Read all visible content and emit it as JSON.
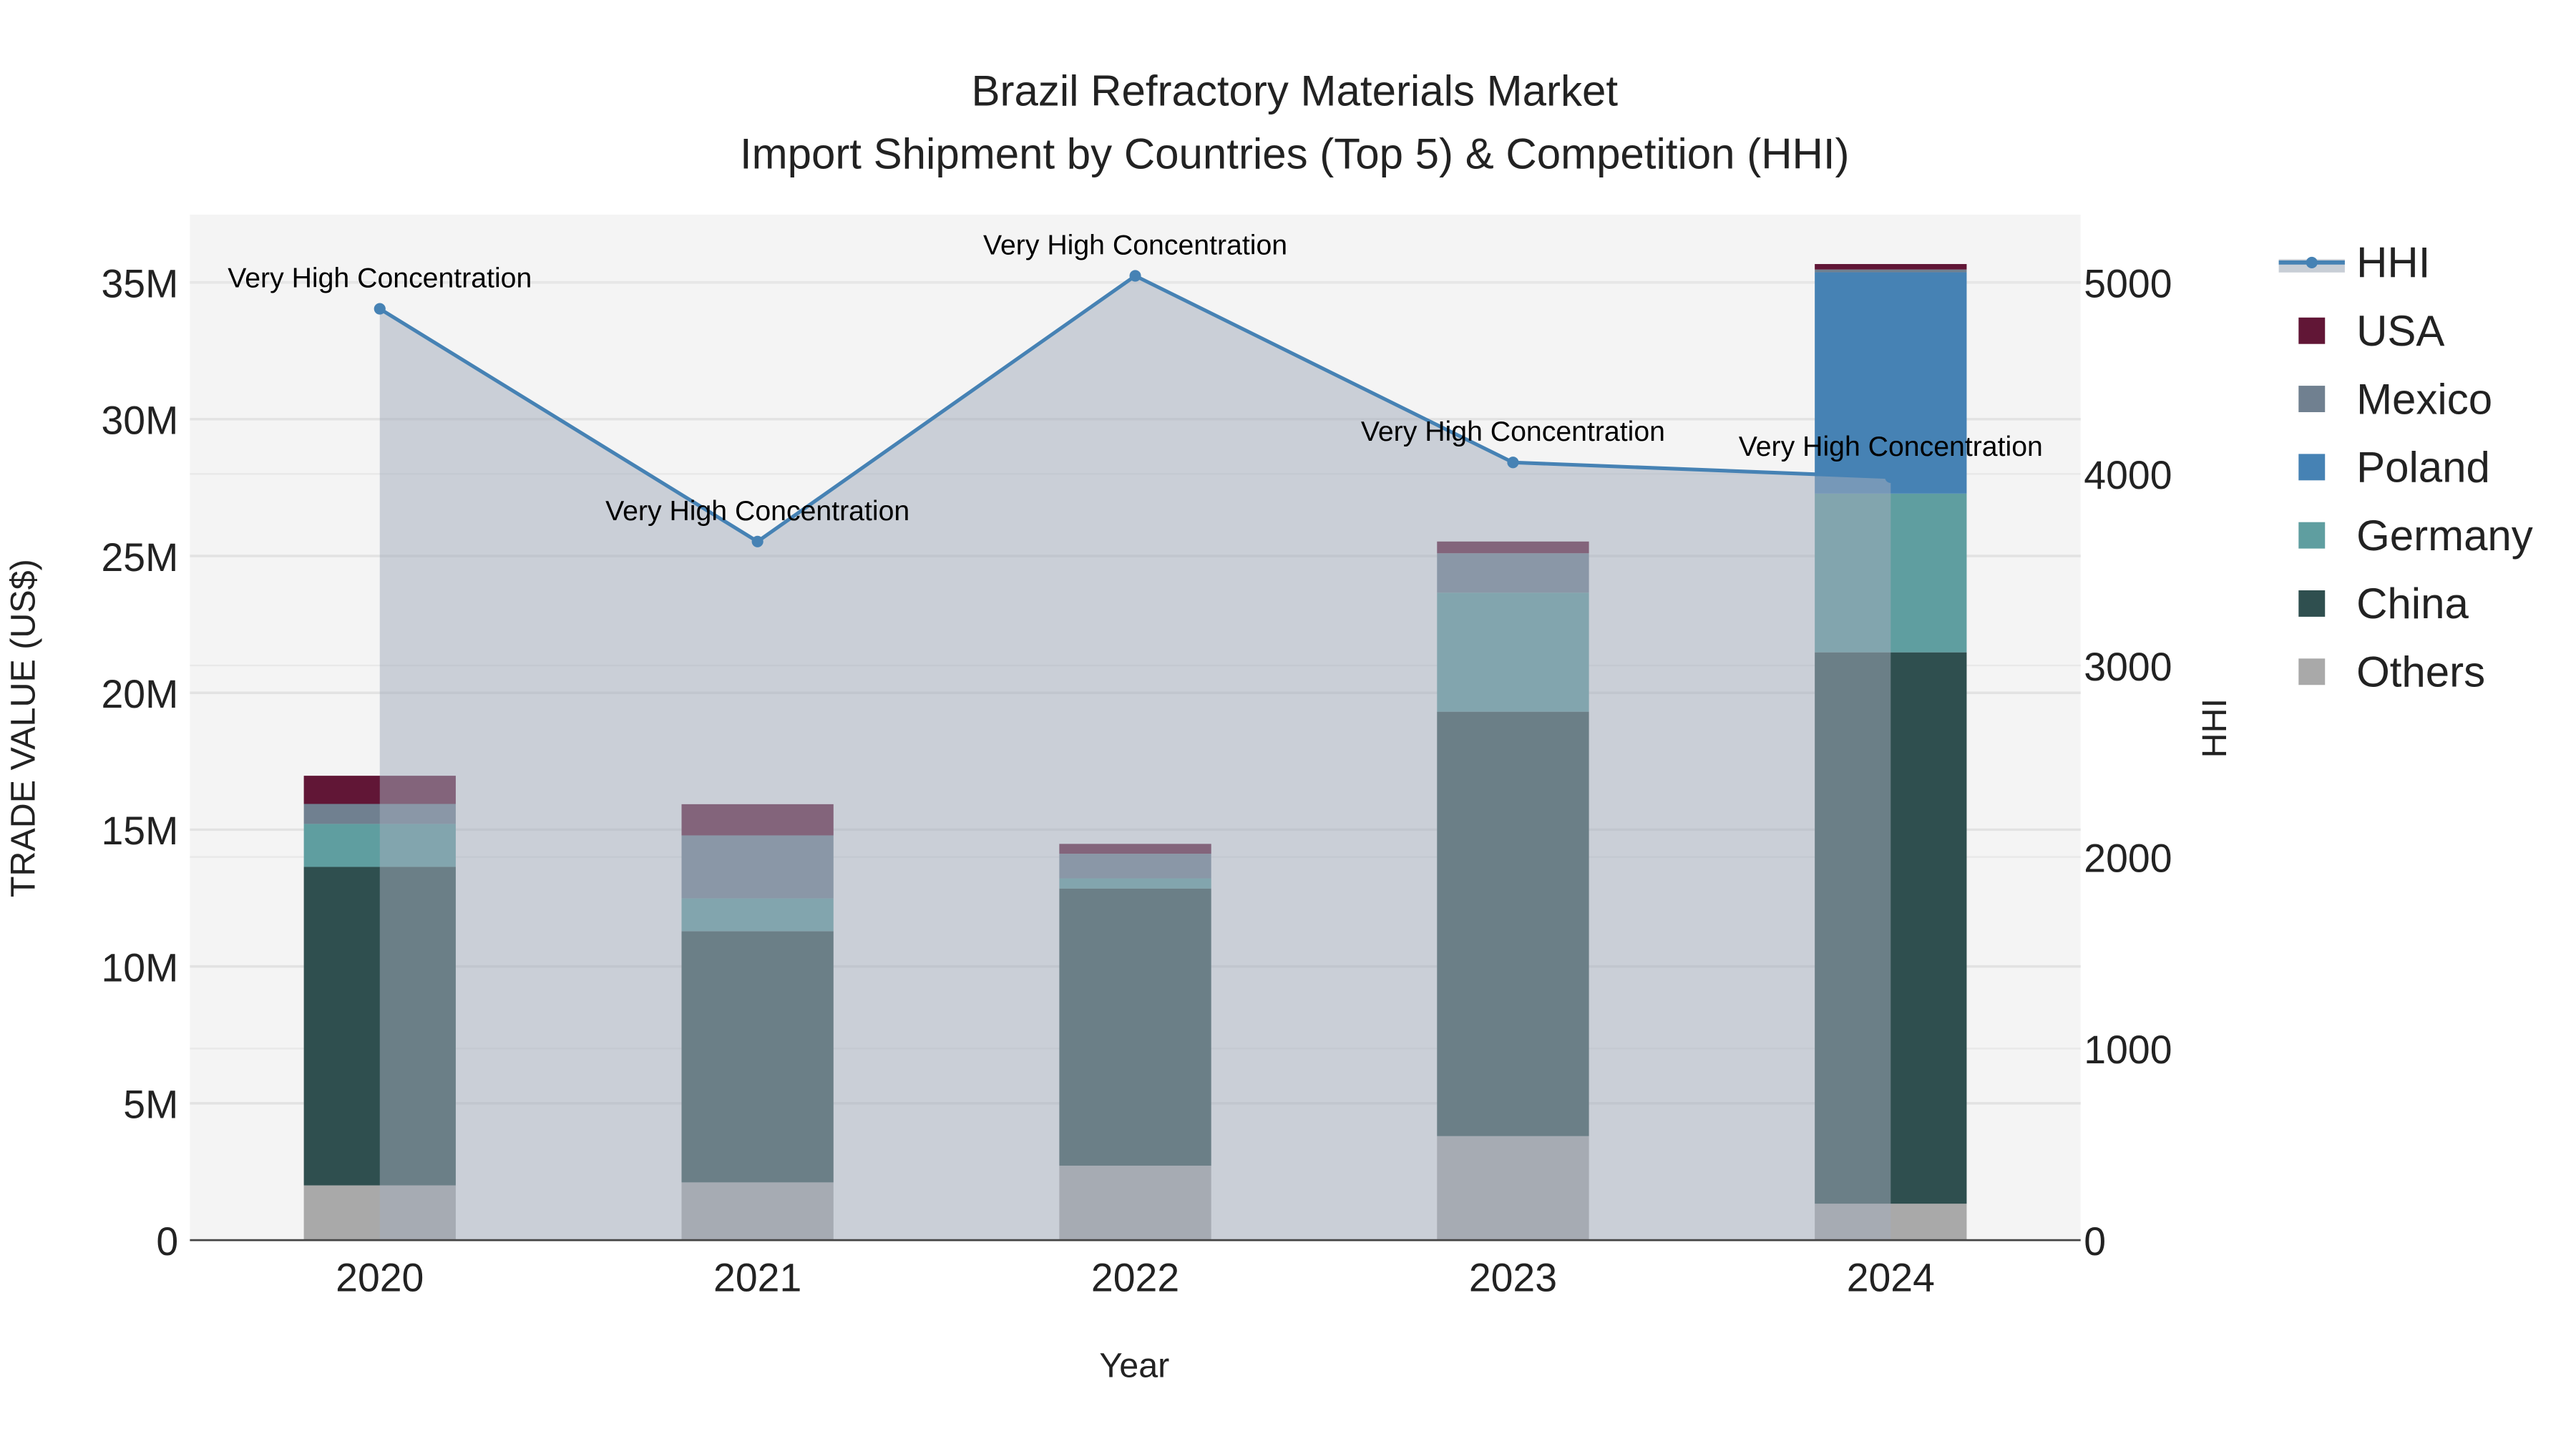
{
  "chart_data": {
    "type": "bar",
    "title": "Brazil Refractory Materials Market",
    "subtitle": "Import Shipment by Countries (Top 5) & Competition (HHI)",
    "xlabel": "Year",
    "ylabel": "TRADE VALUE (US$)",
    "y2label": "HHI",
    "categories": [
      "2020",
      "2021",
      "2022",
      "2023",
      "2024"
    ],
    "ylim": [
      0,
      37500000
    ],
    "y2lim": [
      0,
      5350
    ],
    "yticks": [
      {
        "v": 0,
        "label": "0"
      },
      {
        "v": 5000000,
        "label": "5M"
      },
      {
        "v": 10000000,
        "label": "10M"
      },
      {
        "v": 15000000,
        "label": "15M"
      },
      {
        "v": 20000000,
        "label": "20M"
      },
      {
        "v": 25000000,
        "label": "25M"
      },
      {
        "v": 30000000,
        "label": "30M"
      },
      {
        "v": 35000000,
        "label": "35M"
      }
    ],
    "y2ticks": [
      {
        "v": 0,
        "label": "0"
      },
      {
        "v": 1000,
        "label": "1000"
      },
      {
        "v": 2000,
        "label": "2000"
      },
      {
        "v": 3000,
        "label": "3000"
      },
      {
        "v": 4000,
        "label": "4000"
      },
      {
        "v": 5000,
        "label": "5000"
      }
    ],
    "grid": true,
    "legend_placement": "right",
    "series": [
      {
        "name": "Others",
        "color": "#a9a9a9",
        "values": [
          2000000,
          2110000,
          2720000,
          3800000,
          1330000
        ]
      },
      {
        "name": "China",
        "color": "#2f4f4f",
        "values": [
          11640000,
          9180000,
          10130000,
          15510000,
          20150000
        ]
      },
      {
        "name": "Germany",
        "color": "#5f9ea0",
        "values": [
          1570000,
          1200000,
          370000,
          4350000,
          5800000
        ]
      },
      {
        "name": "Poland",
        "color": "#4682b4",
        "values": [
          0,
          0,
          0,
          0,
          8090000
        ]
      },
      {
        "name": "Mexico",
        "color": "#708090",
        "values": [
          730000,
          2300000,
          900000,
          1440000,
          100000
        ]
      },
      {
        "name": "USA",
        "color": "#611636",
        "values": [
          1030000,
          1140000,
          360000,
          430000,
          200000
        ]
      }
    ],
    "hhi": {
      "name": "HHI",
      "color": "#4682b4",
      "values": [
        4862,
        3647,
        5034,
        4060,
        3983
      ],
      "annotations": [
        "Very High Concentration",
        "Very High Concentration",
        "Very High Concentration",
        "Very High Concentration",
        "Very High Concentration"
      ]
    },
    "legend_order": [
      "HHI",
      "USA",
      "Mexico",
      "Poland",
      "Germany",
      "China",
      "Others"
    ]
  }
}
